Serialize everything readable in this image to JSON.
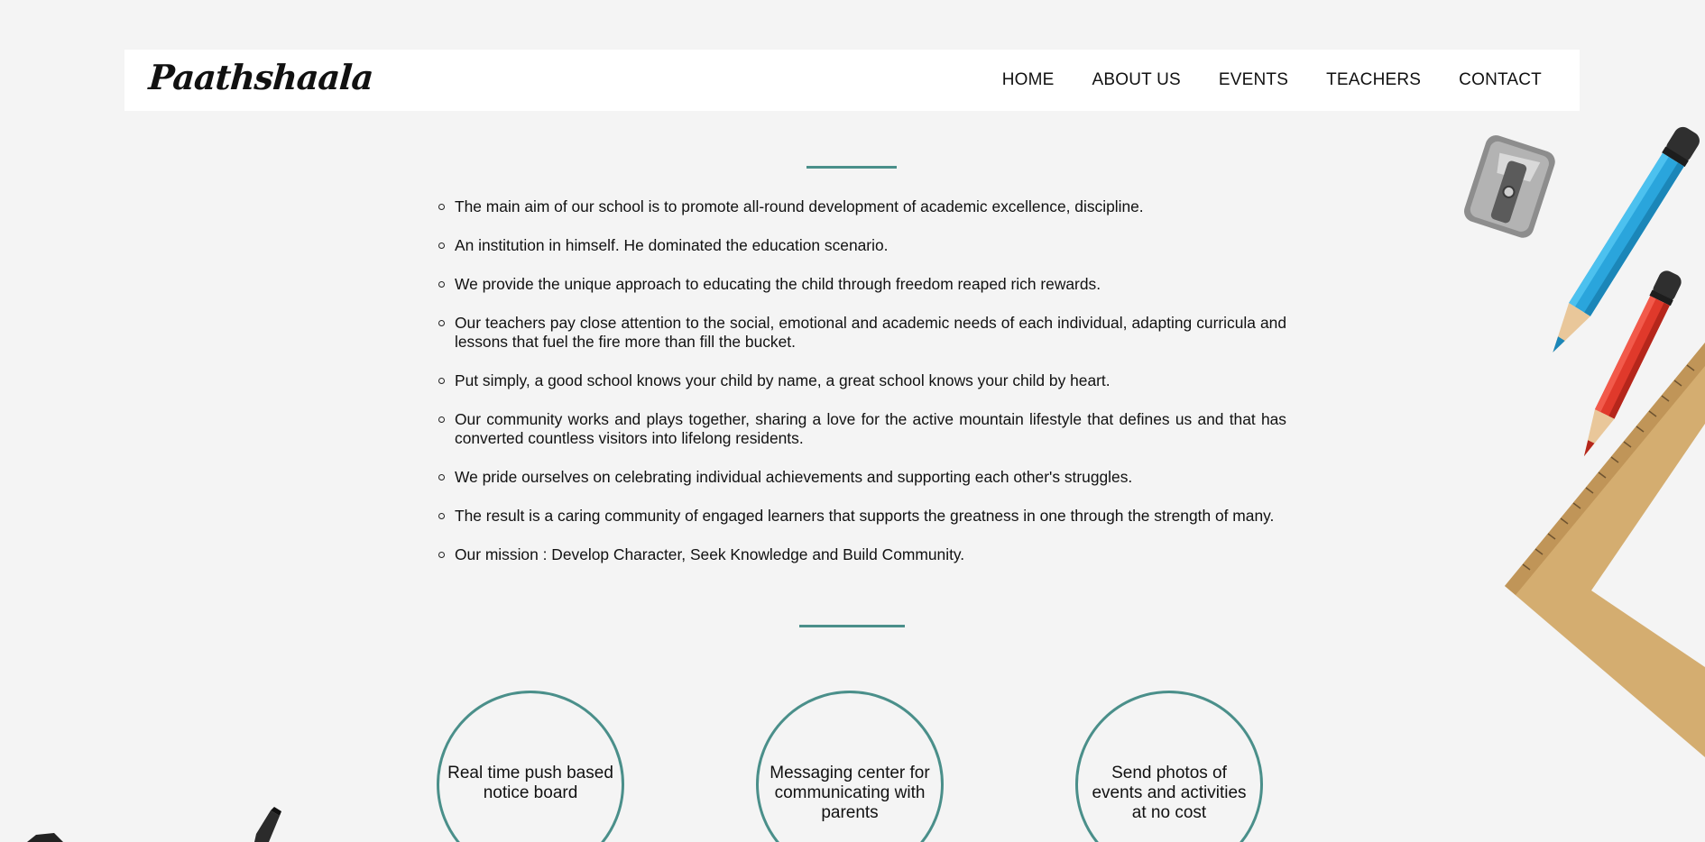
{
  "header": {
    "logo": "Paathshaala",
    "nav": [
      "HOME",
      "ABOUT US",
      "EVENTS",
      "TEACHERS",
      "CONTACT"
    ]
  },
  "mission": [
    "The main aim of our school is to promote all-round development of academic excellence, discipline.",
    "An institution in himself. He dominated the education scenario.",
    "We provide the unique approach to educating the child through freedom reaped rich rewards.",
    "Our teachers pay close attention to the social, emotional and academic needs of each individual, adapting curricula and lessons that fuel the fire more than fill the bucket.",
    "Put simply, a good school knows your child by name, a great school knows your child by heart.",
    "Our community works and plays together, sharing a love for the active mountain lifestyle that defines us and that has converted countless visitors into lifelong residents.",
    "We pride ourselves on celebrating individual achievements and supporting each other's struggles.",
    "The result is a caring community of engaged learners that supports the greatness in one through the strength of many.",
    "Our mission : Develop Character, Seek Knowledge and Build Community."
  ],
  "features": [
    "Real time push based notice board",
    "Messaging center for communicating with parents",
    "Send photos of events and activities at no cost"
  ],
  "colors": {
    "background": "#f4f4f4",
    "accent": "#4a8f8a",
    "navbar": "#ffffff",
    "text": "#111111"
  },
  "decorations": [
    "sharpener-icon",
    "blue-pencil-icon",
    "red-pencil-icon",
    "ruler-triangle-icon",
    "marker-icon"
  ]
}
